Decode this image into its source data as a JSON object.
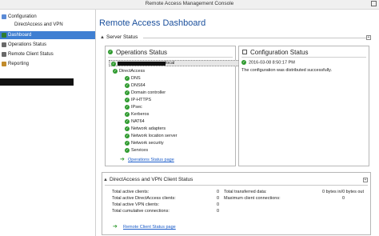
{
  "window": {
    "title": "Remote Access Management Console"
  },
  "nav": {
    "items": [
      {
        "label": "Configuration",
        "color": "#5b8bd6"
      },
      {
        "label": "DirectAccess and VPN",
        "color": ""
      },
      {
        "label": "Dashboard",
        "color": "#2f7d32",
        "selected": true
      },
      {
        "label": "Operations Status",
        "color": "#6a6a6a"
      },
      {
        "label": "Remote Client Status",
        "color": "#6a6a6a"
      },
      {
        "label": "Reporting",
        "color": "#c28c2c"
      }
    ]
  },
  "dashboard": {
    "title": "Remote Access Dashboard",
    "server_status": {
      "label": "Server Status",
      "operations": {
        "title": "Operations Status",
        "server_suffix": "local",
        "directaccess_label": "DirectAccess",
        "services": [
          "DNS",
          "DNS64",
          "Domain controller",
          "IP-HTTPS",
          "IPsec",
          "Kerberos",
          "NAT64",
          "Network adapters",
          "Network location server",
          "Network security",
          "Services"
        ],
        "link": "Operations Status page"
      },
      "configuration": {
        "title": "Configuration Status",
        "timestamp": "2016-03-08 8:50:17 PM",
        "message": "The configuration was distributed successfully."
      }
    },
    "client_status": {
      "label": "DirectAccess and VPN Client Status",
      "left": [
        {
          "label": "Total active clients:",
          "value": "0"
        },
        {
          "label": "Total active DirectAccess clients:",
          "value": "0"
        },
        {
          "label": "Total active VPN clients:",
          "value": "0"
        },
        {
          "label": "Total cumulative connections:",
          "value": "0"
        }
      ],
      "right": [
        {
          "label": "Total transferred data:",
          "value": "0 bytes in/0 bytes out"
        },
        {
          "label": "Maximum client connections:",
          "value": "0"
        }
      ],
      "link": "Remote Client Status page"
    }
  }
}
